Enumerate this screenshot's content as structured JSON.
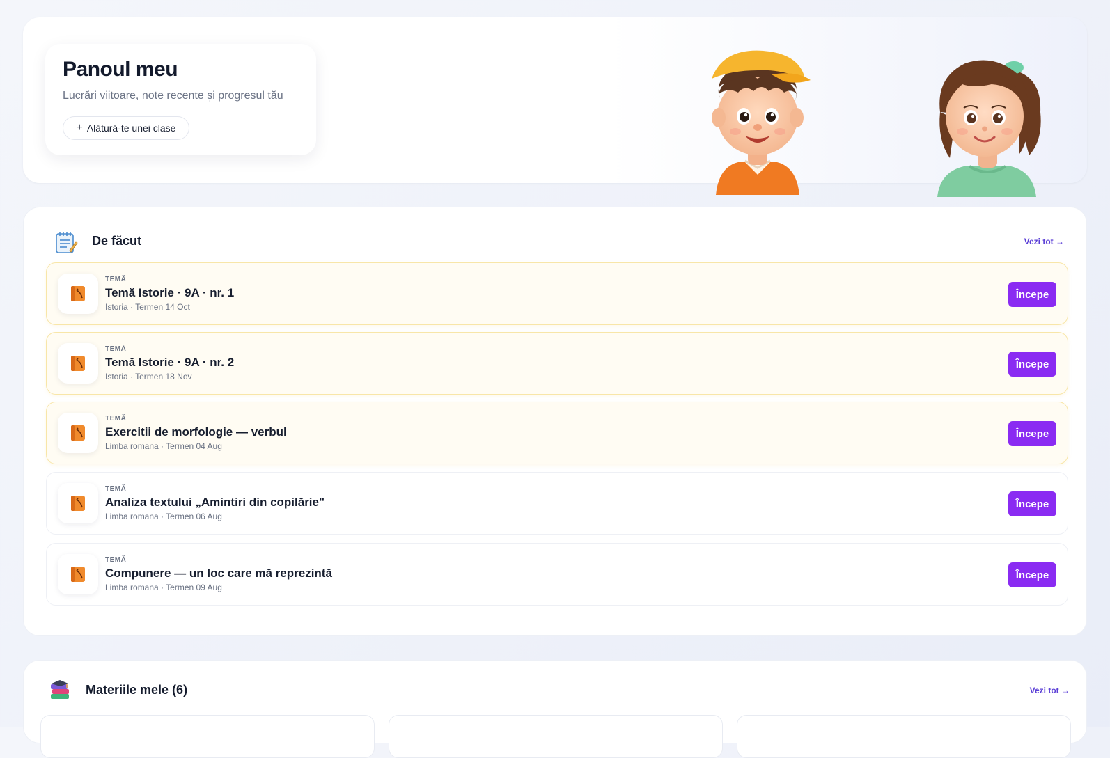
{
  "hero": {
    "title": "Panoul meu",
    "subtitle": "Lucrări viitoare, note recente și progresul tău",
    "join_label": "Alătură-te unei clase"
  },
  "todo": {
    "title": "De făcut",
    "see_all": "Vezi tot →",
    "start_label": "Începe",
    "tasks": [
      {
        "kind": "TEMĂ",
        "title": "Temă Istorie · 9A · nr. 1",
        "meta": "Istoria · Termen 14 Oct",
        "highlighted": true
      },
      {
        "kind": "TEMĂ",
        "title": "Temă Istorie · 9A · nr. 2",
        "meta": "Istoria · Termen 18 Nov",
        "highlighted": true
      },
      {
        "kind": "TEMĂ",
        "title": "Exercitii de morfologie — verbul",
        "meta": "Limba romana · Termen 04 Aug",
        "highlighted": true
      },
      {
        "kind": "TEMĂ",
        "title": "Analiza textului „Amintiri din copilărie\"",
        "meta": "Limba romana · Termen 06 Aug",
        "highlighted": false
      },
      {
        "kind": "TEMĂ",
        "title": "Compunere — un loc care mă reprezintă",
        "meta": "Limba romana · Termen 09 Aug",
        "highlighted": false
      }
    ]
  },
  "subjects": {
    "title": "Materiile mele (6)",
    "see_all": "Vezi tot →"
  },
  "icons": {
    "join": "plus-icon",
    "todo": "notepad-icon",
    "task": "book-icon",
    "subjects": "books-stack-icon"
  },
  "colors": {
    "accent": "#8a2bf2",
    "link": "#5b3fd6",
    "highlight_bg": "#fffcf3",
    "highlight_border": "#f8e6a8"
  }
}
